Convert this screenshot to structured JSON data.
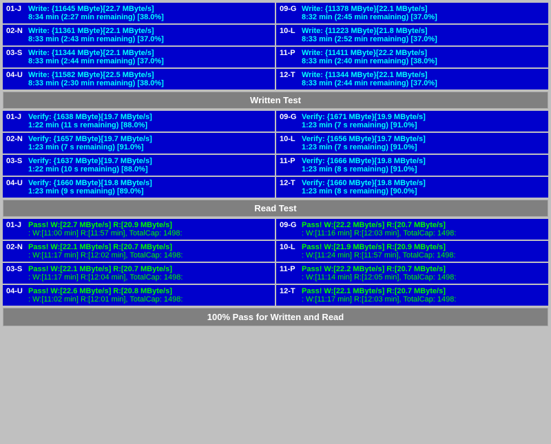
{
  "sections": {
    "written_test_label": "Written Test",
    "read_test_label": "Read Test",
    "footer_label": "100% Pass for Written and Read"
  },
  "write_rows": [
    {
      "left": {
        "id": "01-J",
        "line1": "Write: {11645 MByte}[22.7 MByte/s]",
        "line2": "8:34 min (2:27 min remaining)  [38.0%]"
      },
      "right": {
        "id": "09-G",
        "line1": "Write: {11378 MByte}[22.1 MByte/s]",
        "line2": "8:32 min (2:45 min remaining)  [37.0%]"
      }
    },
    {
      "left": {
        "id": "02-N",
        "line1": "Write: {11361 MByte}[22.1 MByte/s]",
        "line2": "8:33 min (2:43 min remaining)  [37.0%]"
      },
      "right": {
        "id": "10-L",
        "line1": "Write: {11223 MByte}[21.8 MByte/s]",
        "line2": "8:33 min (2:52 min remaining)  [37.0%]"
      }
    },
    {
      "left": {
        "id": "03-S",
        "line1": "Write: {11344 MByte}[22.1 MByte/s]",
        "line2": "8:33 min (2:44 min remaining)  [37.0%]"
      },
      "right": {
        "id": "11-P",
        "line1": "Write: {11411 MByte}[22.2 MByte/s]",
        "line2": "8:33 min (2:40 min remaining)  [38.0%]"
      }
    },
    {
      "left": {
        "id": "04-U",
        "line1": "Write: {11582 MByte}[22.5 MByte/s]",
        "line2": "8:33 min (2:30 min remaining)  [38.0%]"
      },
      "right": {
        "id": "12-T",
        "line1": "Write: {11344 MByte}[22.1 MByte/s]",
        "line2": "8:33 min (2:44 min remaining)  [37.0%]"
      }
    }
  ],
  "verify_rows": [
    {
      "left": {
        "id": "01-J",
        "line1": "Verify: {1638 MByte}[19.7 MByte/s]",
        "line2": "1:22 min (11 s remaining)   [88.0%]"
      },
      "right": {
        "id": "09-G",
        "line1": "Verify: {1671 MByte}[19.9 MByte/s]",
        "line2": "1:23 min (7 s remaining)   [91.0%]"
      }
    },
    {
      "left": {
        "id": "02-N",
        "line1": "Verify: {1657 MByte}[19.7 MByte/s]",
        "line2": "1:23 min (7 s remaining)   [91.0%]"
      },
      "right": {
        "id": "10-L",
        "line1": "Verify: {1656 MByte}[19.7 MByte/s]",
        "line2": "1:23 min (7 s remaining)   [91.0%]"
      }
    },
    {
      "left": {
        "id": "03-S",
        "line1": "Verify: {1637 MByte}[19.7 MByte/s]",
        "line2": "1:22 min (10 s remaining)   [88.0%]"
      },
      "right": {
        "id": "11-P",
        "line1": "Verify: {1666 MByte}[19.8 MByte/s]",
        "line2": "1:23 min (8 s remaining)   [91.0%]"
      }
    },
    {
      "left": {
        "id": "04-U",
        "line1": "Verify: {1660 MByte}[19.8 MByte/s]",
        "line2": "1:23 min (9 s remaining)   [89.0%]"
      },
      "right": {
        "id": "12-T",
        "line1": "Verify: {1660 MByte}[19.8 MByte/s]",
        "line2": "1:23 min (8 s remaining)   [90.0%]"
      }
    }
  ],
  "pass_rows": [
    {
      "left": {
        "id": "01-J",
        "line1": "Pass! W:[22.7 MByte/s] R:[20.9 MByte/s]",
        "line2": ": W:[11:00 min] R:[11:57 min], TotalCap: 1498:"
      },
      "right": {
        "id": "09-G",
        "line1": "Pass! W:[22.2 MByte/s] R:[20.7 MByte/s]",
        "line2": ": W:[11:16 min] R:[12:03 min], TotalCap: 1498:"
      }
    },
    {
      "left": {
        "id": "02-N",
        "line1": "Pass! W:[22.1 MByte/s] R:[20.7 MByte/s]",
        "line2": ": W:[11:17 min] R:[12:02 min], TotalCap: 1498:"
      },
      "right": {
        "id": "10-L",
        "line1": "Pass! W:[21.9 MByte/s] R:[20.9 MByte/s]",
        "line2": ": W:[11:24 min] R:[11:57 min], TotalCap: 1498:"
      }
    },
    {
      "left": {
        "id": "03-S",
        "line1": "Pass! W:[22.1 MByte/s] R:[20.7 MByte/s]",
        "line2": ": W:[11:17 min] R:[12:04 min], TotalCap: 1498:"
      },
      "right": {
        "id": "11-P",
        "line1": "Pass! W:[22.2 MByte/s] R:[20.7 MByte/s]",
        "line2": ": W:[11:14 min] R:[12:05 min], TotalCap: 1498:"
      }
    },
    {
      "left": {
        "id": "04-U",
        "line1": "Pass! W:[22.6 MByte/s] R:[20.8 MByte/s]",
        "line2": ": W:[11:02 min] R:[12:01 min], TotalCap: 1498:"
      },
      "right": {
        "id": "12-T",
        "line1": "Pass! W:[22.1 MByte/s] R:[20.7 MByte/s]",
        "line2": ": W:[11:17 min] R:[12:03 min], TotalCap: 1498:"
      }
    }
  ]
}
